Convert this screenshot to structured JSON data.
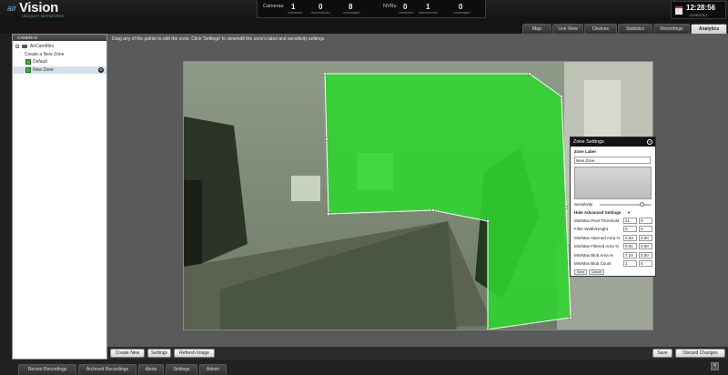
{
  "header": {
    "logo": {
      "air": "air",
      "vision": "Vision",
      "sub": "UBIQUITI NETWORKS"
    },
    "cameras": {
      "label": "Cameras:",
      "connected": "1",
      "disconnected": "0",
      "unmanaged": "8"
    },
    "nvrs": {
      "label": "NVRs:",
      "connected": "0",
      "disconnected": "1",
      "unmanaged": "0"
    },
    "captions": {
      "connected": "connected",
      "disconnected": "disconnected",
      "unmanaged": "unmanaged"
    },
    "clock": {
      "time": "12:28:56",
      "date": "12/06/2012"
    }
  },
  "nav": {
    "tabs": [
      "Map",
      "Live View",
      "Devices",
      "Statistics",
      "Recordings",
      "Analytics"
    ],
    "active": "Analytics"
  },
  "sidebar": {
    "header": "CAMERAS",
    "camera": "AirCamMini",
    "create_new_zone": "Create a New Zone",
    "zones": [
      "Default",
      "New Zone"
    ],
    "selected_zone": "New Zone"
  },
  "main": {
    "instruction": "Drag any of the points to edit the zone. Click 'Settings' to view/edit the zone's label and sensitivity settings."
  },
  "zone_settings": {
    "title": "Zone Settings",
    "label_heading": "Zone Label",
    "label_value": "New Zone",
    "sensitivity_label": "Sensitivity",
    "sensitivity": 0.82,
    "advanced_label": "Hide Advanced Settings",
    "advanced_arrow": "▼",
    "rows": [
      {
        "label": "Min/Max Pixel Threshold",
        "min": "21",
        "max": "0"
      },
      {
        "label": "Filter Width/Height",
        "min": "0",
        "max": "0"
      },
      {
        "label": "Min/Max Alarmed Area %",
        "min": "0.63",
        "max": "0.00"
      },
      {
        "label": "Min/Max Filtered Area %",
        "min": "0.01",
        "max": "0.00"
      },
      {
        "label": "Min/Max Blob Area %",
        "min": "7.24",
        "max": "0.00"
      },
      {
        "label": "Min/Max Blob Count",
        "min": "1",
        "max": "0"
      }
    ],
    "buttons": {
      "apply": "Save",
      "reset": "Cancel"
    }
  },
  "toolbar": {
    "create_new": "Create New",
    "settings": "Settings",
    "refresh_image": "Refresh Image",
    "save": "Save",
    "discard": "Discard Changes"
  },
  "footer": {
    "tabs": [
      "Recent Recordings",
      "Archived Recordings",
      "Alerts",
      "Settings",
      "Admin"
    ],
    "close": "×"
  },
  "colors": {
    "zone_fill": "#2dd62d",
    "zone_stroke": "#ffffff",
    "accent": "#7db7e6"
  },
  "icons": [
    "calendar-icon",
    "camera-icon",
    "zone-icon",
    "close-icon",
    "gear-icon",
    "expand-arrow-icon"
  ]
}
